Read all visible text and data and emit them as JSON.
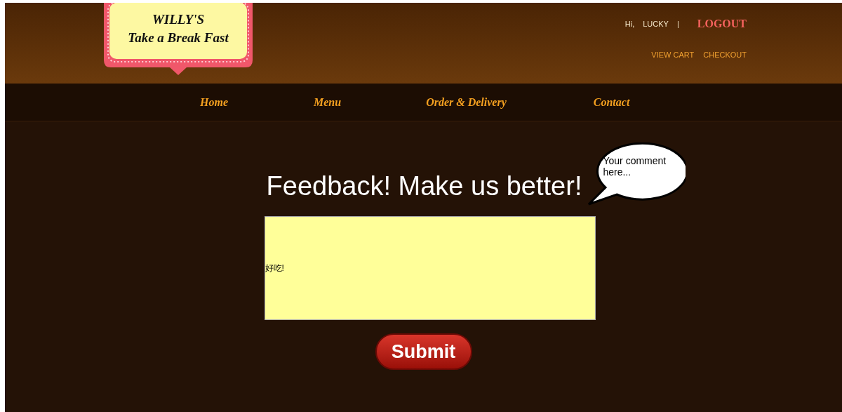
{
  "logo": {
    "title": "WILLY'S",
    "tagline": "Take a Break Fast"
  },
  "account": {
    "greeting": "Hi,",
    "user": "LUCKY",
    "separator": "|",
    "logout": "LOGOUT",
    "links": [
      "VIEW CART",
      "CHECKOUT"
    ]
  },
  "nav": [
    "Home",
    "Menu",
    "Order & Delivery",
    "Contact"
  ],
  "feedback": {
    "heading": "Feedback! Make us better!",
    "bubble": "Your comment here...",
    "value": "好吃!",
    "submit": "Submit"
  }
}
